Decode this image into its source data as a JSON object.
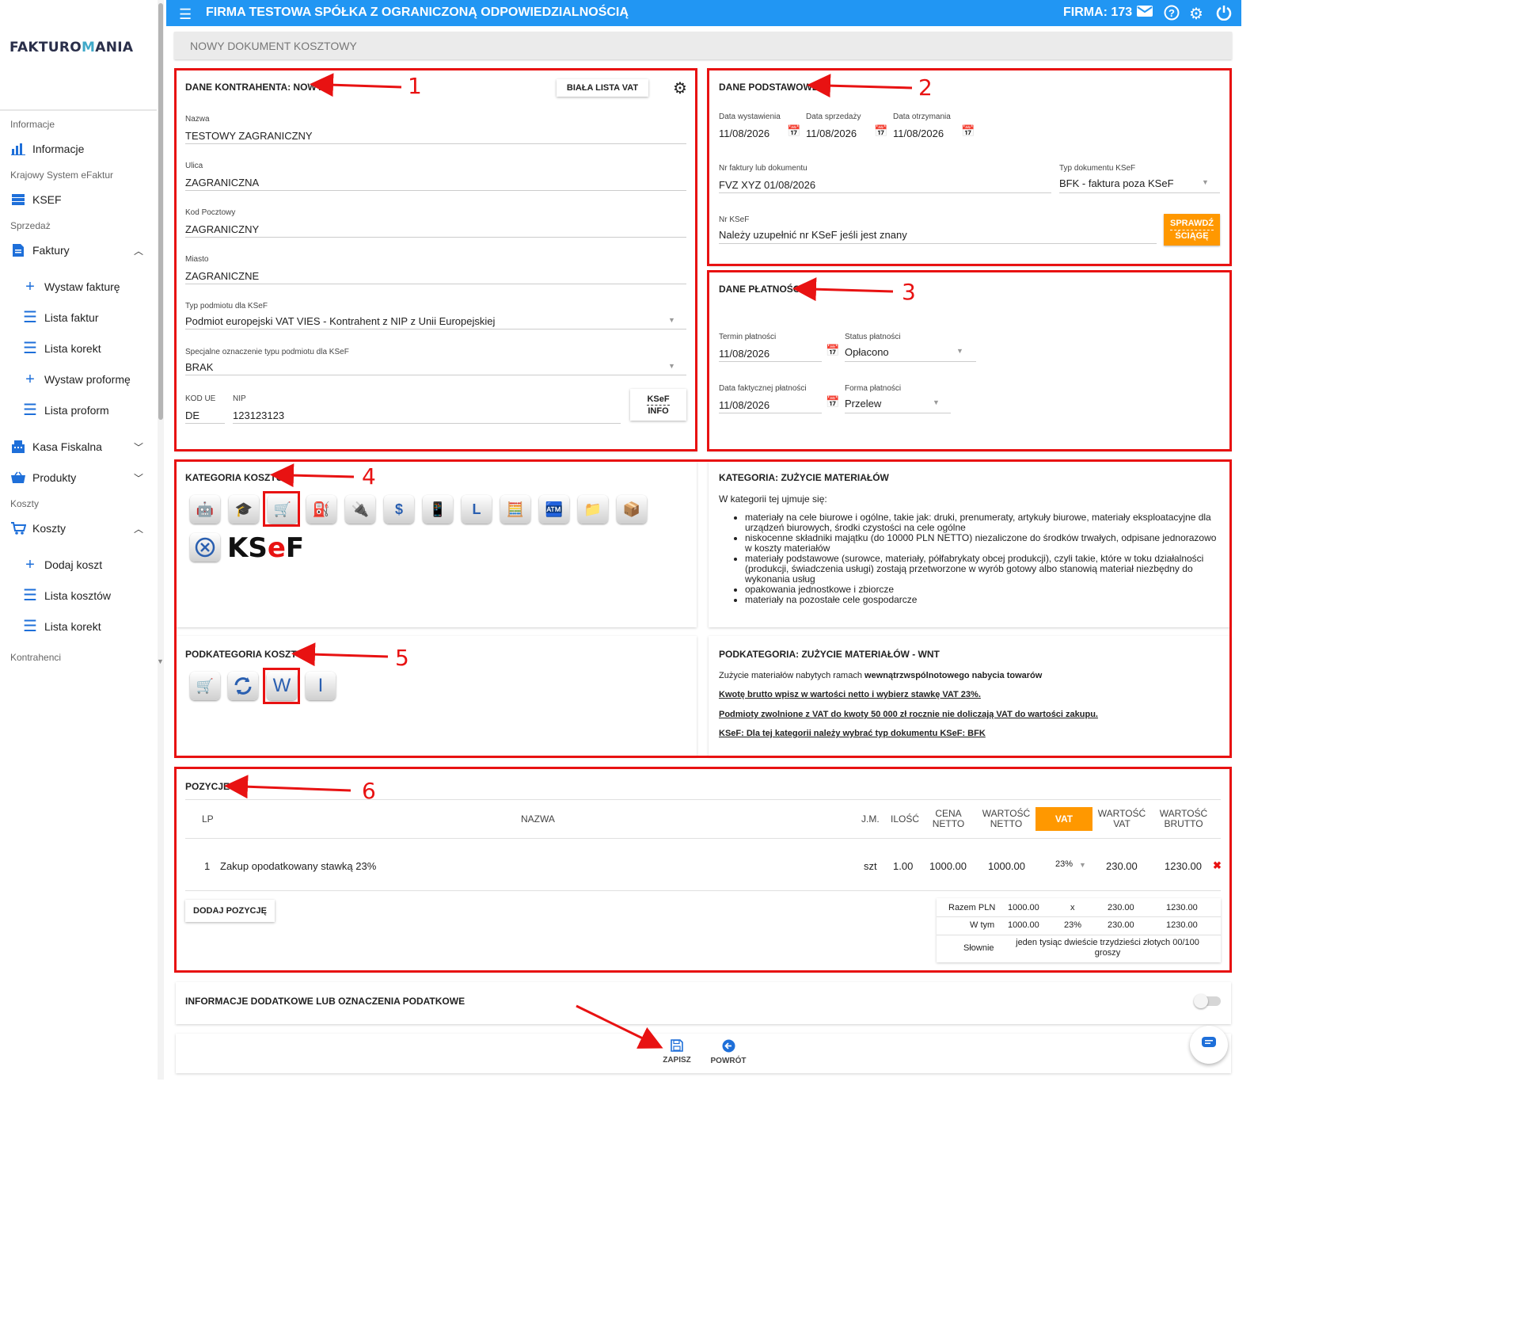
{
  "app": {
    "logo_left": "FAKTURO",
    "logo_m": "M",
    "logo_right": "ANIA",
    "company_title": "FIRMA TESTOWA SPÓŁKA Z OGRANICZONĄ ODPOWIEDZIALNOŚCIĄ",
    "firma_label": "FIRMA: 173",
    "accent": "#2196f3",
    "highlight": "#ff9800",
    "annotation": "#e81212"
  },
  "sidebar": {
    "s_informacje": "Informacje",
    "informacje": "Informacje",
    "s_ksef": "Krajowy System eFaktur",
    "ksef": "KSEF",
    "s_sprzedaz": "Sprzedaż",
    "faktury": "Faktury",
    "wystaw_fakture": "Wystaw fakturę",
    "lista_faktur": "Lista faktur",
    "lista_korekt": "Lista korekt",
    "wystaw_proforme": "Wystaw proformę",
    "lista_proform": "Lista proform",
    "kasa": "Kasa Fiskalna",
    "produkty": "Produkty",
    "s_koszty": "Koszty",
    "koszty": "Koszty",
    "dodaj_koszt": "Dodaj koszt",
    "lista_kosztow": "Lista kosztów",
    "lista_korekt2": "Lista korekt",
    "s_kontrahenci": "Kontrahenci"
  },
  "doc_title": "NOWY DOKUMENT KOSZTOWY",
  "contractor": {
    "heading": "DANE KONTRAHENTA: NOWY",
    "biala_lista": "BIAŁA LISTA VAT",
    "nazwa_label": "Nazwa",
    "nazwa": "TESTOWY ZAGRANICZNY",
    "ulica_label": "Ulica",
    "ulica": "ZAGRANICZNA",
    "kod_label": "Kod Pocztowy",
    "kod": "ZAGRANICZNY",
    "miasto_label": "Miasto",
    "miasto": "ZAGRANICZNE",
    "typ_label": "Typ podmiotu dla KSeF",
    "typ": "Podmiot europejski VAT VIES - Kontrahent z NIP z Unii Europejskiej",
    "spec_label": "Specjalne oznaczenie typu podmiotu dla KSeF",
    "spec": "BRAK",
    "kodue_label": "KOD UE",
    "kodue": "DE",
    "nip_label": "NIP",
    "nip": "123123123",
    "ksef_info_1": "KSeF",
    "ksef_info_2": "INFO"
  },
  "basic": {
    "heading": "DANE PODSTAWOWE",
    "data_wyst_label": "Data wystawienia",
    "data_wyst": "11/08/2026",
    "data_sprz_label": "Data sprzedaży",
    "data_sprz": "11/08/2026",
    "data_otrz_label": "Data otrzymania",
    "data_otrz": "11/08/2026",
    "nr_label": "Nr faktury lub dokumentu",
    "nr": "FVZ XYZ 01/08/2026",
    "typdok_label": "Typ dokumentu KSeF",
    "typdok": "BFK - faktura poza KSeF",
    "nrksef_label": "Nr KSeF",
    "nrksef": "Należy uzupełnić nr KSeF jeśli jest znany",
    "sprawdz_1": "SPRAWDŹ",
    "sprawdz_2": "ŚCIĄGĘ"
  },
  "payment": {
    "heading": "DANE PŁATNOŚCI",
    "termin_label": "Termin płatności",
    "termin": "11/08/2026",
    "status_label": "Status płatności",
    "status": "Opłacono",
    "data_fakt_label": "Data faktycznej płatności",
    "data_fakt": "11/08/2026",
    "forma_label": "Forma płatności",
    "forma": "Przelew"
  },
  "category": {
    "heading": "KATEGORIA KOSZTU",
    "info_heading": "KATEGORIA: ZUŻYCIE MATERIAŁÓW",
    "info_intro": "W kategorii tej ujmuje się:",
    "bullets": [
      "materiały na cele biurowe i ogólne, takie jak: druki, prenumeraty, artykuły biurowe, materiały eksploatacyjne dla urządzeń biurowych, środki czystości na cele ogólne",
      "niskocenne składniki majątku (do 10000 PLN NETTO) niezaliczone do środków trwałych, odpisane jednorazowo w koszty materiałów",
      "materiały podstawowe (surowce, materiały, półfabrykaty obcej produkcji), czyli takie, które w toku działalności (produkcji, świadczenia usługi) zostają przetworzone w wyrób gotowy albo stanowią materiał niezbędny do wykonania usług",
      "opakowania jednostkowe i zbiorcze",
      "materiały na pozostałe cele gospodarcze"
    ],
    "ksef_logo": "KSeF"
  },
  "subcategory": {
    "heading": "PODKATEGORIA KOSZTU",
    "info_heading": "PODKATEGORIA: ZUŻYCIE MATERIAŁÓW - WNT",
    "line1_a": "Zużycie materiałów nabytych ramach ",
    "line1_b": "wewnątrzwspólnotowego nabycia towarów",
    "line2": "Kwotę brutto wpisz w wartości netto i wybierz stawkę VAT 23%.",
    "line3": "Podmioty zwolnione z VAT do kwoty 50 000 zł rocznie nie doliczają VAT do wartości zakupu.",
    "line4": "KSeF: Dla tej kategorii należy wybrać typ dokumentu KSeF: BFK"
  },
  "positions": {
    "heading": "POZYCJE",
    "cols": {
      "lp": "LP",
      "nazwa": "NAZWA",
      "jm": "J.M.",
      "ilosc": "ILOŚĆ",
      "cena_1": "CENA",
      "cena_2": "NETTO",
      "wn_1": "WARTOŚĆ",
      "wn_2": "NETTO",
      "vat": "VAT",
      "wv_1": "WARTOŚĆ",
      "wv_2": "VAT",
      "wb_1": "WARTOŚĆ",
      "wb_2": "BRUTTO"
    },
    "row": {
      "lp": "1",
      "nazwa": "Zakup opodatkowany stawką 23%",
      "jm": "szt",
      "ilosc": "1.00",
      "cena": "1000.00",
      "wn": "1000.00",
      "vat": "23%",
      "wv": "230.00",
      "wb": "1230.00"
    },
    "add": "DODAJ POZYCJĘ",
    "summary": {
      "r1_l": "Razem PLN",
      "r1_a": "1000.00",
      "r1_b": "x",
      "r1_c": "230.00",
      "r1_d": "1230.00",
      "r2_l": "W tym",
      "r2_a": "1000.00",
      "r2_b": "23%",
      "r2_c": "230.00",
      "r2_d": "1230.00",
      "r3_l": "Słownie",
      "r3_v": "jeden tysiąc dwieście trzydzieści złotych 00/100 groszy"
    }
  },
  "extra": {
    "heading": "INFORMACJE DODATKOWE LUB OZNACZENIA PODATKOWE"
  },
  "footer": {
    "save": "ZAPISZ",
    "back": "POWRÓT"
  },
  "annotations": [
    "1",
    "2",
    "3",
    "4",
    "5",
    "6"
  ]
}
